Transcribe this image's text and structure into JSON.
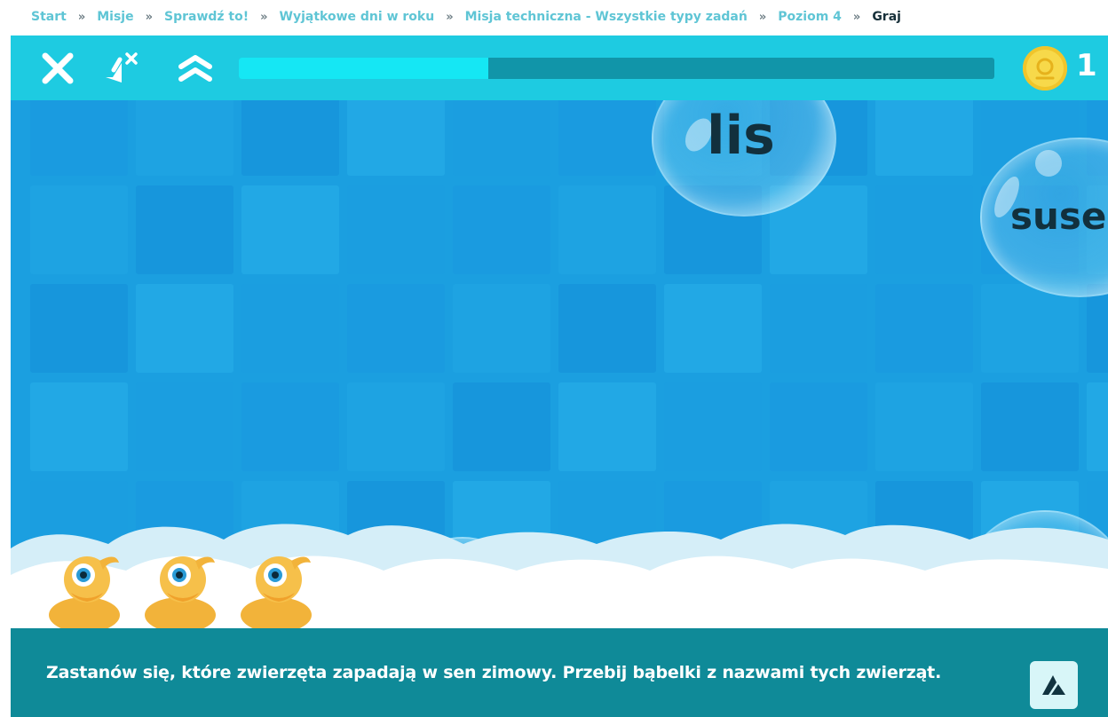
{
  "breadcrumb": {
    "items": [
      "Start",
      "Misje",
      "Sprawdź to!",
      "Wyjątkowe dni w roku",
      "Misja techniczna - Wszystkie typy zadań",
      "Poziom 4"
    ],
    "separator": "»",
    "current": "Graj"
  },
  "toolbar": {
    "close_icon": "close-icon",
    "mute_icon": "sound-off-icon",
    "levels_icon": "chevrons-up-icon",
    "progress_fraction": 0.33,
    "coin_count": "1"
  },
  "bubbles": [
    {
      "word": "lis"
    },
    {
      "word": "suse"
    }
  ],
  "ducks": {
    "count": 3
  },
  "instructions": {
    "text": "Zastanów się, które zwierzęta zapadają w sen zimowy. Przebij bąbelki z nazwami tych zwierząt."
  },
  "colors": {
    "toolbar": "#1ecbe1",
    "play_background": "#1b9fe0",
    "progress_fill": "#15e7f4",
    "progress_track": "#1195a9",
    "instructions_bar": "#0f8a98",
    "breadcrumb_link": "#5fc5d5"
  }
}
